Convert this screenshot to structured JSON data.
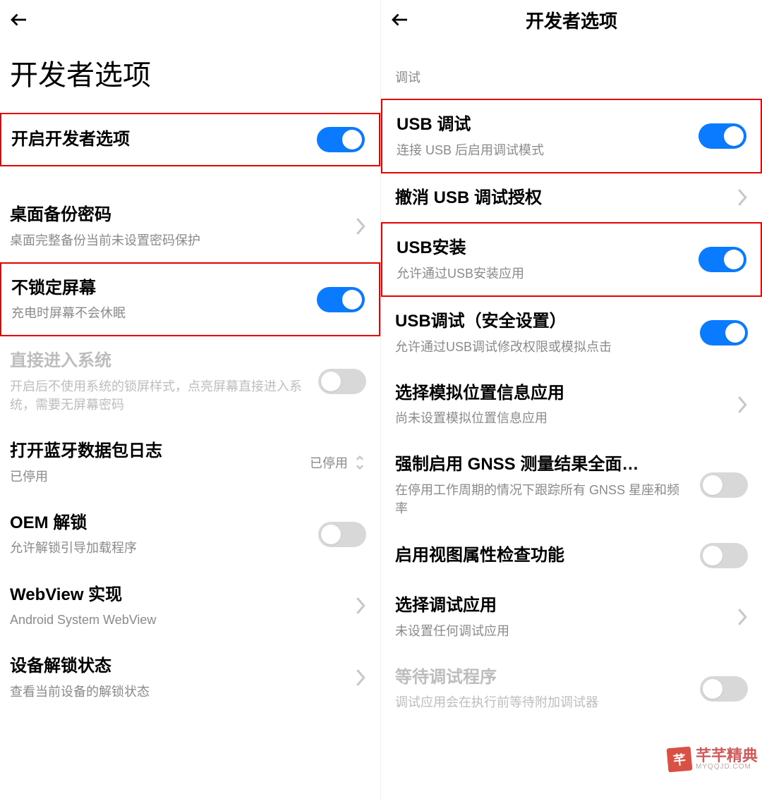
{
  "left": {
    "title": "开发者选项",
    "items": [
      {
        "title": "开启开发者选项",
        "control": "toggle",
        "on": true,
        "highlight": true
      },
      {
        "title": "桌面备份密码",
        "subtitle": "桌面完整备份当前未设置密码保护",
        "control": "chevron"
      },
      {
        "title": "不锁定屏幕",
        "subtitle": "充电时屏幕不会休眠",
        "control": "toggle",
        "on": true,
        "highlight": true
      },
      {
        "title": "直接进入系统",
        "subtitle": "开启后不使用系统的锁屏样式，点亮屏幕直接进入系统，需要无屏幕密码",
        "control": "toggle",
        "on": false,
        "disabled": true
      },
      {
        "title": "打开蓝牙数据包日志",
        "subtitle": "已停用",
        "control": "status-updown",
        "status": "已停用"
      },
      {
        "title": "OEM 解锁",
        "subtitle": "允许解锁引导加载程序",
        "control": "toggle",
        "on": false
      },
      {
        "title": "WebView 实现",
        "subtitle": "Android System WebView",
        "control": "chevron"
      },
      {
        "title": "设备解锁状态",
        "subtitle": "查看当前设备的解锁状态",
        "control": "chevron"
      }
    ]
  },
  "right": {
    "header_title": "开发者选项",
    "section": "调试",
    "items": [
      {
        "title": "USB 调试",
        "subtitle": "连接 USB 后启用调试模式",
        "control": "toggle",
        "on": true,
        "highlight": true
      },
      {
        "title": "撤消 USB 调试授权",
        "control": "chevron"
      },
      {
        "title": "USB安装",
        "subtitle": "允许通过USB安装应用",
        "control": "toggle",
        "on": true,
        "highlight": true
      },
      {
        "title": "USB调试（安全设置）",
        "subtitle": "允许通过USB调试修改权限或模拟点击",
        "control": "toggle",
        "on": true
      },
      {
        "title": "选择模拟位置信息应用",
        "subtitle": "尚未设置模拟位置信息应用",
        "control": "chevron"
      },
      {
        "title": "强制启用 GNSS 测量结果全面…",
        "subtitle": "在停用工作周期的情况下跟踪所有 GNSS 星座和频率",
        "control": "toggle",
        "on": false
      },
      {
        "title": "启用视图属性检查功能",
        "control": "toggle",
        "on": false
      },
      {
        "title": "选择调试应用",
        "subtitle": "未设置任何调试应用",
        "control": "chevron"
      },
      {
        "title": "等待调试程序",
        "subtitle": "调试应用会在执行前等待附加调试器",
        "control": "toggle",
        "on": false,
        "disabled": true
      }
    ]
  },
  "watermark": {
    "brand": "芊芊精典",
    "url": "MYQQJD.COM"
  }
}
